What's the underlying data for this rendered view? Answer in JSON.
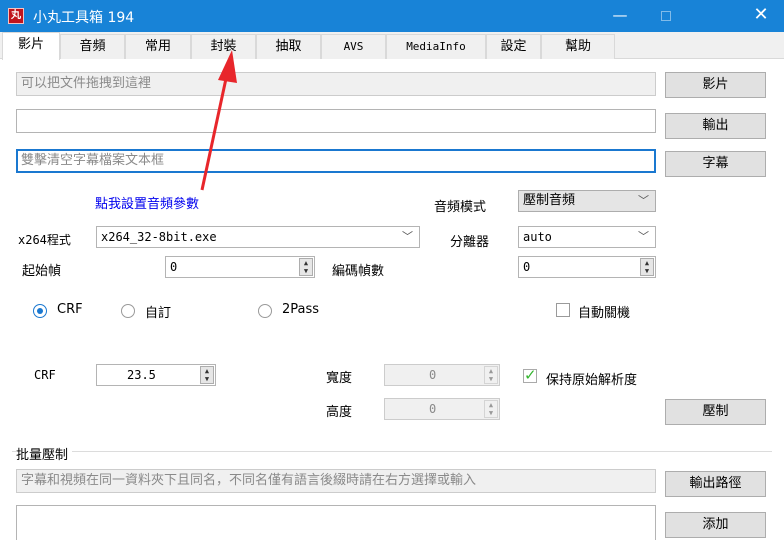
{
  "window": {
    "title": "小丸工具箱 194",
    "icon_letter": "丸",
    "minimize": "—",
    "close": "✕"
  },
  "tabs": [
    {
      "label": "影片"
    },
    {
      "label": "音頻"
    },
    {
      "label": "常用"
    },
    {
      "label": "封裝"
    },
    {
      "label": "抽取"
    },
    {
      "label": "AVS"
    },
    {
      "label": "MediaInfo"
    },
    {
      "label": "設定"
    },
    {
      "label": "幫助"
    }
  ],
  "video": {
    "input_placeholder": "可以把文件拖拽到這裡",
    "input_button": "影片",
    "output_value": "",
    "output_button": "輸出",
    "subtitle_placeholder": "雙擊清空字幕檔案文本框",
    "subtitle_button": "字幕",
    "audio_settings_link": "點我設置音頻參數",
    "audio_mode_label": "音頻模式",
    "audio_mode_value": "壓制音頻",
    "x264_label": "x264程式",
    "x264_value": "x264_32-8bit.exe",
    "splitter_label": "分離器",
    "splitter_value": "auto",
    "start_frame_label": "起始幀",
    "start_frame_value": "0",
    "encode_frames_label": "編碼幀數",
    "encode_frames_value": "0",
    "mode_crf": "CRF",
    "mode_custom": "自訂",
    "mode_2pass": "2Pass",
    "auto_shutdown": "自動關機",
    "crf_label": "CRF",
    "crf_value": "23.5",
    "width_label": "寬度",
    "width_value": "0",
    "height_label": "高度",
    "height_value": "0",
    "keep_resolution": "保持原始解析度",
    "encode_button": "壓制"
  },
  "batch": {
    "group_title": "批量壓制",
    "hint_placeholder": "字幕和視頻在同一資料夾下且同名，不同名僅有語言後綴時請在右方選擇或輸入",
    "output_path_button": "輸出路徑",
    "add_button": "添加"
  },
  "colors": {
    "titlebar": "#1883d7",
    "arrow": "#e8262b",
    "link": "#0000ee",
    "check": "#35b530"
  }
}
